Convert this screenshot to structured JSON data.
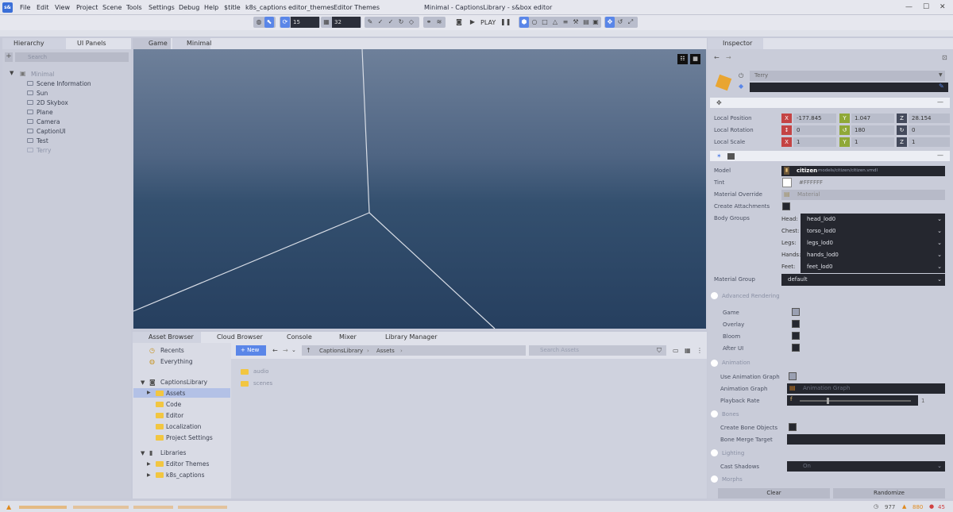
{
  "app": {
    "logo": "s&",
    "title": "Minimal - CaptionsLibrary - s&box editor"
  },
  "menu": [
    "File",
    "Edit",
    "View",
    "Project",
    "Scene",
    "Tools",
    "Settings",
    "Debug",
    "Help",
    "$title",
    "k8s_captions",
    "editor_themes",
    "Editor Themes"
  ],
  "toolbar": {
    "snap_angle": "15",
    "grid_size": "32",
    "play_label": "PLAY"
  },
  "hierarchy": {
    "tab_hierarchy": "Hierarchy",
    "tab_ui_panels": "UI Panels",
    "search_placeholder": "Search",
    "root": "Minimal",
    "items": [
      "Scene Information",
      "Sun",
      "2D Skybox",
      "Plane",
      "Camera",
      "CaptionUI",
      "Test",
      "Terry"
    ]
  },
  "viewport": {
    "tab_game": "Game",
    "tab_minimal": "Minimal"
  },
  "bottom_tabs": [
    "Asset Browser",
    "Cloud Browser",
    "Console",
    "Mixer",
    "Library Manager"
  ],
  "asset_tree": {
    "recents": "Recents",
    "everything": "Everything",
    "project": "CaptionsLibrary",
    "folders": [
      "Assets",
      "Code",
      "Editor",
      "Localization",
      "Project Settings"
    ],
    "libraries": "Libraries",
    "library_items": [
      "Editor Themes",
      "k8s_captions"
    ]
  },
  "asset_browser": {
    "new_label": "New",
    "breadcrumb": [
      "CaptionsLibrary",
      "Assets"
    ],
    "search_placeholder": "Search Assets",
    "files": [
      "audio",
      "scenes"
    ]
  },
  "inspector": {
    "tab": "Inspector",
    "object_name": "Terry",
    "transform": {
      "local_position_label": "Local Position",
      "local_rotation_label": "Local Rotation",
      "local_scale_label": "Local Scale",
      "position": [
        "-177.845",
        "1.047",
        "28.154"
      ],
      "rotation": [
        "0",
        "180",
        "0"
      ],
      "scale": [
        "1",
        "1",
        "1"
      ]
    },
    "model": {
      "model_label": "Model",
      "model_name": "citizen",
      "model_path": "models/citizen/citizen.vmdl",
      "tint_label": "Tint",
      "tint_value": "#FFFFFF",
      "material_override_label": "Material Override",
      "material_placeholder": "Material",
      "create_attachments_label": "Create Attachments",
      "body_groups_label": "Body Groups",
      "body_groups": [
        {
          "part": "Head:",
          "value": "head_lod0"
        },
        {
          "part": "Chest:",
          "value": "torso_lod0"
        },
        {
          "part": "Legs:",
          "value": "legs_lod0"
        },
        {
          "part": "Hands:",
          "value": "hands_lod0"
        },
        {
          "part": "Feet:",
          "value": "feet_lod0"
        }
      ],
      "material_group_label": "Material Group",
      "material_group_value": "default"
    },
    "advanced_rendering": {
      "title": "Advanced Rendering",
      "items": [
        "Game",
        "Overlay",
        "Bloom",
        "After UI"
      ]
    },
    "animation": {
      "title": "Animation",
      "use_graph_label": "Use Animation Graph",
      "graph_label": "Animation Graph",
      "graph_placeholder": "Animation Graph",
      "playback_label": "Playback Rate",
      "playback_value": "1"
    },
    "bones": {
      "title": "Bones",
      "create_label": "Create Bone Objects",
      "merge_label": "Bone Merge Target"
    },
    "lighting": {
      "title": "Lighting",
      "cast_shadows_label": "Cast Shadows",
      "cast_shadows_value": "On"
    },
    "morphs_title": "Morphs",
    "clear_label": "Clear",
    "randomize_label": "Randomize"
  },
  "status": {
    "fps": "977",
    "warnings": "880",
    "errors": "45"
  },
  "colors": {
    "accent": "#5a86e8",
    "folder": "#f2c641",
    "viewport_top": "#6e809a",
    "viewport_bottom": "#263f5f",
    "x_axis": "#c44444",
    "y_axis": "#8fa838",
    "z_axis": "#444a5c"
  }
}
